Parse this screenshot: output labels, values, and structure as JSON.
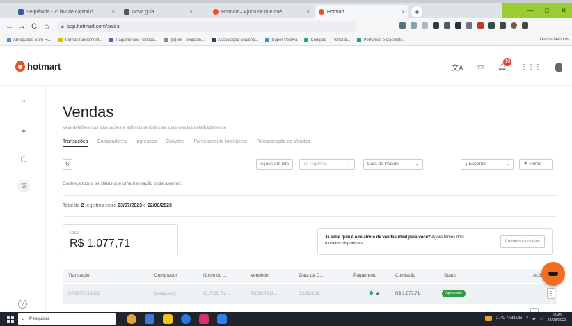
{
  "browser": {
    "tabs": [
      {
        "label": "Sequência - 7º link de capital d... ",
        "color": "#3b5998"
      },
      {
        "label": "Nova guia",
        "color": "#555555"
      },
      {
        "label": "Hotmart – Ajuda de que quê...",
        "color": "#f04e23"
      },
      {
        "label": "Hotmart",
        "color": "#f04e23"
      }
    ],
    "url": "app.hotmart.com/sales",
    "bookmarks": [
      {
        "label": "Abrogados Sem Fi...",
        "color": "#4a90d9"
      },
      {
        "label": "Termos fundament...",
        "color": "#e6b800"
      },
      {
        "label": "Pagamentos Palítica...",
        "color": "#8e44ad"
      },
      {
        "label": "[st]em | Ilimitado...",
        "color": "#888888"
      },
      {
        "label": "Associação Gaúcha...",
        "color": "#2c3e50"
      },
      {
        "label": "Super Vestiva",
        "color": "#3498db"
      },
      {
        "label": "Códigos — Portal d...",
        "color": "#27ae60"
      },
      {
        "label": "Perfumes e Cosméti...",
        "color": "#16a085"
      }
    ],
    "bookmarks_right": "Outros favoritos"
  },
  "header": {
    "logo_text": "hotmart",
    "notification_count": "10"
  },
  "page": {
    "title": "Vendas",
    "subtitle": "Veja detalhes das transações e administre todas as suas vendas detalhadamente",
    "tabs": [
      "Transações",
      "Compradores",
      "Ingressos",
      "Convites",
      "Parcelamento Inteligente",
      "Recuperação de Vendas"
    ],
    "toolbar": {
      "refresh_icon": "↻",
      "actions_label": "Ações em lote",
      "registers_label": "10 registros",
      "date_label": "Data do Pedido",
      "export_label": "Exportar",
      "filters_label": "Filtros"
    },
    "info_text": "Conheça todos os status que uma transação pode assumir.",
    "total_prefix": "Total de",
    "total_count": "2",
    "total_middle": "registros entre",
    "date_from": "23/07/2023",
    "date_conj": "e",
    "date_to": "22/08/2023",
    "total_card": {
      "label": "Total",
      "value": "R$ 1.077,71"
    },
    "report": {
      "text_bold": "Já sabe qual é o relatório de vendas ideal para você?",
      "text_rest": " Agora temos dois modelos disponíveis",
      "button": "Conhecer modelos"
    },
    "table": {
      "headers": [
        "Transação",
        "Comprador",
        "Nome do ...",
        "Vendedor",
        "Data da C...",
        "Pagamento",
        "Comissão",
        "Status",
        "Ações"
      ],
      "rows": [
        {
          "transaction": "HP0907198621",
          "buyer": "(redacted)...",
          "product": "CURSO FL...",
          "seller": "TUDO FLU...",
          "date": "22/08/202...",
          "commission": "R$ 1.077,71",
          "status": "Aprovado"
        }
      ]
    }
  },
  "taskbar": {
    "search_placeholder": "Pesquisar",
    "weather": "27°C Nublado",
    "time": "10:45",
    "date": "22/08/2023"
  }
}
